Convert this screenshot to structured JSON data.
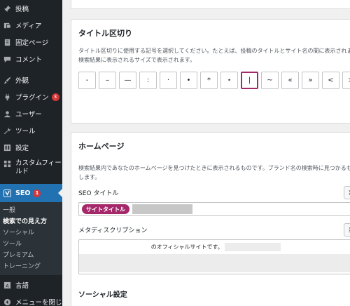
{
  "sidebar": {
    "items": [
      {
        "label": "投稿",
        "icon": "pin-icon"
      },
      {
        "label": "メディア",
        "icon": "media-icon"
      },
      {
        "label": "固定ページ",
        "icon": "page-icon"
      },
      {
        "label": "コメント",
        "icon": "comment-icon"
      },
      {
        "label": "外観",
        "icon": "brush-icon"
      },
      {
        "label": "プラグイン",
        "icon": "plugin-icon",
        "badge": "3"
      },
      {
        "label": "ユーザー",
        "icon": "user-icon"
      },
      {
        "label": "ツール",
        "icon": "wrench-icon"
      },
      {
        "label": "設定",
        "icon": "settings-icon"
      },
      {
        "label": "カスタムフィールド",
        "icon": "grid-icon"
      }
    ],
    "seo": {
      "label": "SEO",
      "badge": "1"
    },
    "submenu": [
      "一般",
      "検索での見え方",
      "ソーシャル",
      "ツール",
      "プレミアム",
      "トレーニング"
    ],
    "current_submenu": "検索での見え方",
    "lang": "言語",
    "collapse": "メニューを閉じる"
  },
  "separator_card": {
    "title": "タイトル区切り",
    "description": "タイトル区切りに使用する記号を選択してください。たとえば、投稿のタイトルとサイト名の間に表示されます。記号は検索結果に表示されるサイズで表示されます。",
    "separators": [
      "-",
      "–",
      "—",
      ":",
      "·",
      "•",
      "*",
      "⋆",
      "|",
      "~",
      "«",
      "»",
      "<",
      ">"
    ],
    "selected_index": 8
  },
  "homepage_card": {
    "title": "ホームページ",
    "description": "検索結果内であなたのホームページを見つけたときに表示されるものです。ブランド名の検索時に見つかるものでも意味します。",
    "seo_title_label": "SEO タイトル",
    "insert_label": "変数を挿入",
    "site_title_tag": "サイトタイトル",
    "meta_label": "メタディスクリプション",
    "meta_text": "のオフィシャルサイトです。",
    "social_title": "ソーシャル設定"
  },
  "colors": {
    "accent": "#a4286a",
    "admin_blue": "#2271b1",
    "sidebar_bg": "#1d2327"
  }
}
